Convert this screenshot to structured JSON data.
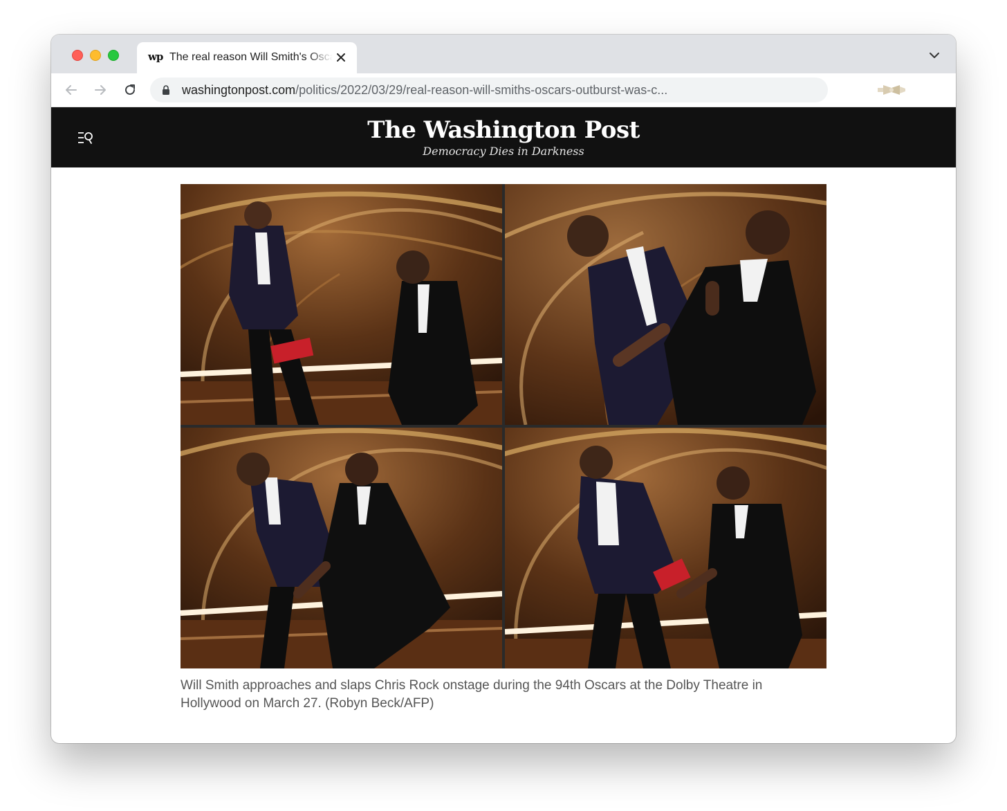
{
  "browser": {
    "tab": {
      "favicon_text": "wp",
      "title": "The real reason Will Smith's Oscars outburst was c"
    },
    "address_bar": {
      "host": "washingtonpost.com",
      "path": "/politics/2022/03/29/real-reason-will-smiths-oscars-outburst-was-c..."
    },
    "icons": {
      "back": "arrow-left-icon",
      "forward": "arrow-right-icon",
      "reload": "reload-icon",
      "lock": "lock-icon",
      "close_tab": "close-icon",
      "tab_menu": "chevron-down-icon",
      "extension": "extension-icon"
    }
  },
  "site_header": {
    "masthead": "The Washington Post",
    "tagline": "Democracy Dies in Darkness",
    "menu_icon": "menu-search-icon",
    "background": "#111111"
  },
  "article": {
    "photo": {
      "panels": [
        {
          "name": "photo-panel-1"
        },
        {
          "name": "photo-panel-2"
        },
        {
          "name": "photo-panel-3"
        },
        {
          "name": "photo-panel-4"
        }
      ]
    },
    "caption": "Will Smith approaches and slaps Chris Rock onstage during the 94th Oscars at the Dolby Theatre in Hollywood on March 27. (Robyn Beck/AFP)"
  },
  "colors": {
    "traffic_red": "#ff5f57",
    "traffic_yellow": "#febc2e",
    "traffic_green": "#28c840",
    "stage_gold": "#c89a55",
    "stage_dark": "#3a1e0c"
  }
}
